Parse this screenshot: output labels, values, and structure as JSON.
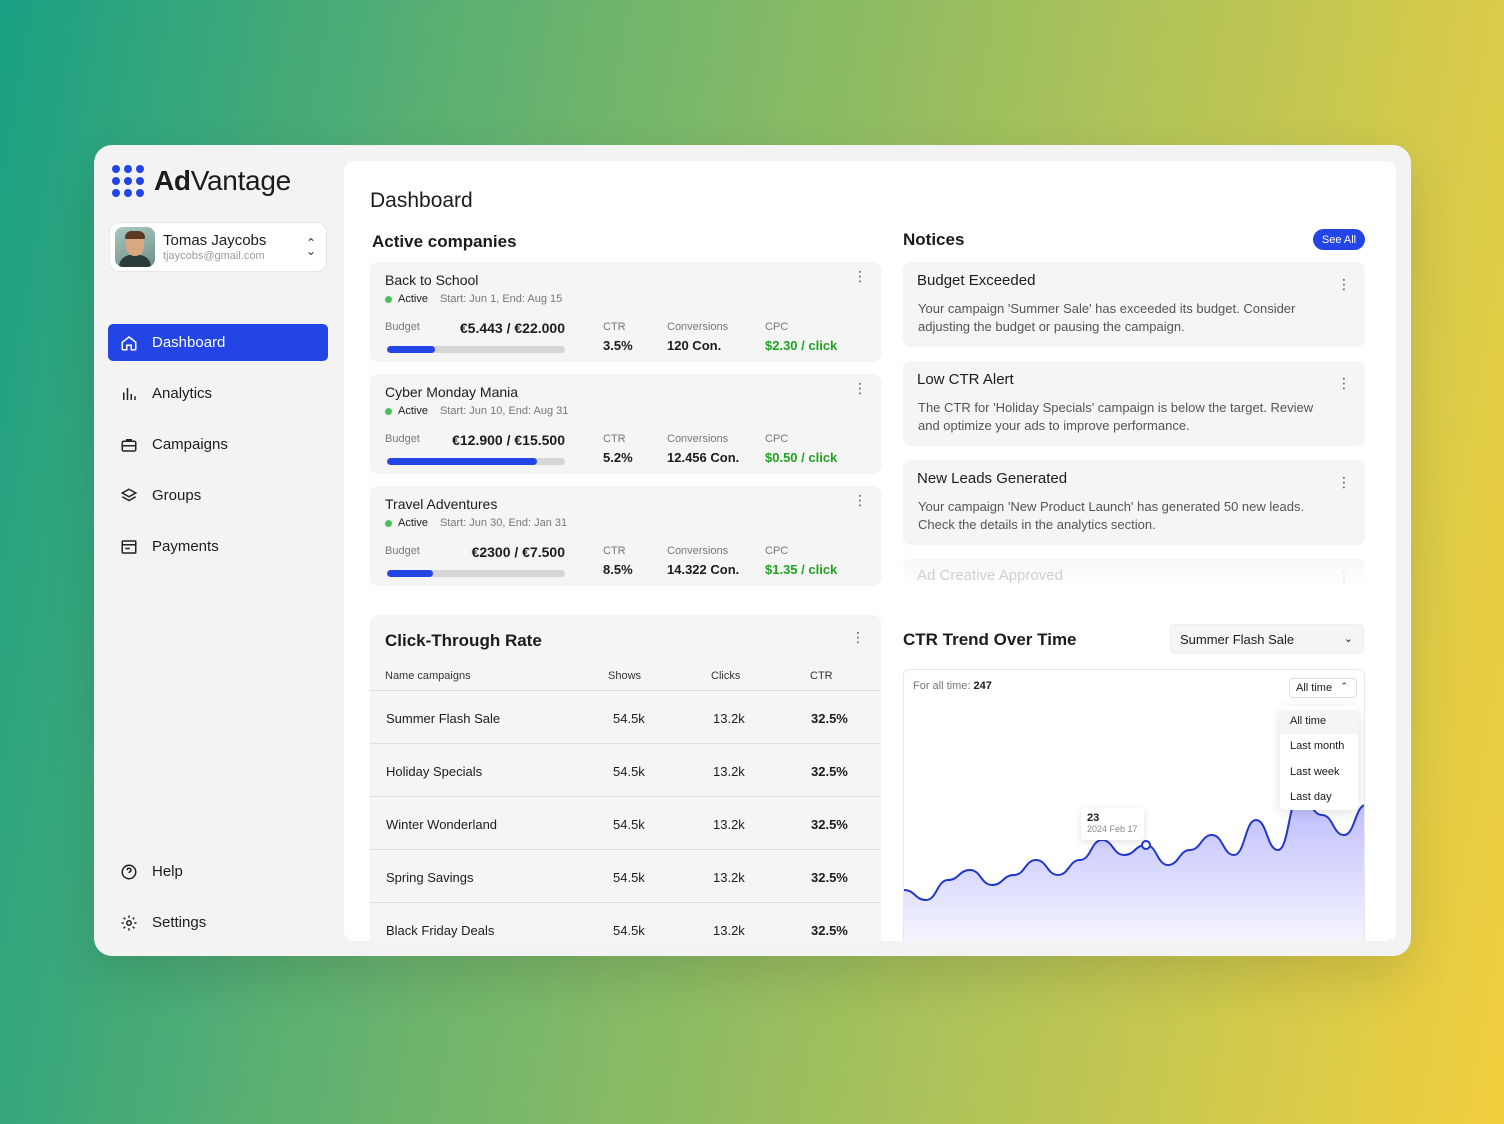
{
  "brand": {
    "name_bold": "Ad",
    "name_rest": "Vantage",
    "accent": "#2445e6"
  },
  "user": {
    "name": "Tomas Jaycobs",
    "email": "tjaycobs@gmail.com"
  },
  "nav": [
    {
      "label": "Dashboard",
      "icon": "home-icon",
      "active": true
    },
    {
      "label": "Analytics",
      "icon": "bar-chart-icon"
    },
    {
      "label": "Campaigns",
      "icon": "briefcase-icon"
    },
    {
      "label": "Groups",
      "icon": "layers-icon"
    },
    {
      "label": "Payments",
      "icon": "receipt-icon"
    }
  ],
  "nav_bottom": [
    {
      "label": "Help",
      "icon": "help-icon"
    },
    {
      "label": "Settings",
      "icon": "gear-icon"
    }
  ],
  "page_title": "Dashboard",
  "active_companies": {
    "title": "Active companies",
    "budget_label": "Budget",
    "ctr_label": "CTR",
    "conv_label": "Conversions",
    "cpc_label": "CPC",
    "items": [
      {
        "name": "Back to School",
        "status": "Active",
        "dates": "Start: Jun 1, End: Aug 15",
        "budget": "€5.443 / €22.000",
        "budget_progress": 0.27,
        "ctr": "3.5%",
        "conversions": "120 Con.",
        "cpc": "$2.30 / click"
      },
      {
        "name": "Cyber Monday Mania",
        "status": "Active",
        "dates": "Start: Jun 10, End: Aug 31",
        "budget": "€12.900 / €15.500",
        "budget_progress": 0.84,
        "ctr": "5.2%",
        "conversions": "12.456 Con.",
        "cpc": "$0.50 / click"
      },
      {
        "name": "Travel Adventures",
        "status": "Active",
        "dates": "Start: Jun 30, End: Jan 31",
        "budget": "€2300 / €7.500",
        "budget_progress": 0.26,
        "ctr": "8.5%",
        "conversions": "14.322 Con.",
        "cpc": "$1.35 / click"
      }
    ]
  },
  "notices": {
    "title": "Notices",
    "see_all": "See All",
    "items": [
      {
        "title": "Budget Exceeded",
        "body": "Your campaign 'Summer Sale' has exceeded its budget. Consider adjusting the budget or pausing the campaign."
      },
      {
        "title": "Low CTR Alert",
        "body": "The CTR for 'Holiday Specials' campaign is below the target. Review and optimize your ads to improve performance."
      },
      {
        "title": "New Leads Generated",
        "body": "Your campaign 'New Product Launch' has generated 50 new leads. Check the details in the analytics section."
      },
      {
        "title": "Ad Creative Approved",
        "body": ""
      }
    ]
  },
  "ctr_table": {
    "title": "Click-Through Rate",
    "headers": [
      "Name campaigns",
      "Shows",
      "Clicks",
      "CTR"
    ],
    "rows": [
      [
        "Summer Flash Sale",
        "54.5k",
        "13.2k",
        "32.5%"
      ],
      [
        "Holiday Specials",
        "54.5k",
        "13.2k",
        "32.5%"
      ],
      [
        "Winter Wonderland",
        "54.5k",
        "13.2k",
        "32.5%"
      ],
      [
        "Spring Savings",
        "54.5k",
        "13.2k",
        "32.5%"
      ],
      [
        "Black Friday Deals",
        "54.5k",
        "13.2k",
        "32.5%"
      ]
    ]
  },
  "trend": {
    "title": "CTR Trend Over Time",
    "campaign_select": "Summer Flash Sale",
    "total_label": "For all time:",
    "total_value": "247",
    "range_selected": "All time",
    "range_options": [
      "All time",
      "Last month",
      "Last week",
      "Last day"
    ],
    "tooltip_value": "23",
    "tooltip_date": "2024 Feb 17",
    "line_color": "#2238c8",
    "fill_color": "#b9b8ff"
  },
  "chart_data": {
    "type": "area",
    "title": "CTR Trend Over Time",
    "y": [
      14,
      12,
      16,
      18,
      15,
      17,
      20,
      17,
      20,
      24,
      21,
      23,
      19,
      22,
      25,
      21,
      28,
      22,
      33,
      29,
      25,
      31
    ],
    "highlight": {
      "value": 23,
      "label": "2024 Feb 17"
    },
    "ylim": [
      0,
      40
    ],
    "grid": false
  }
}
